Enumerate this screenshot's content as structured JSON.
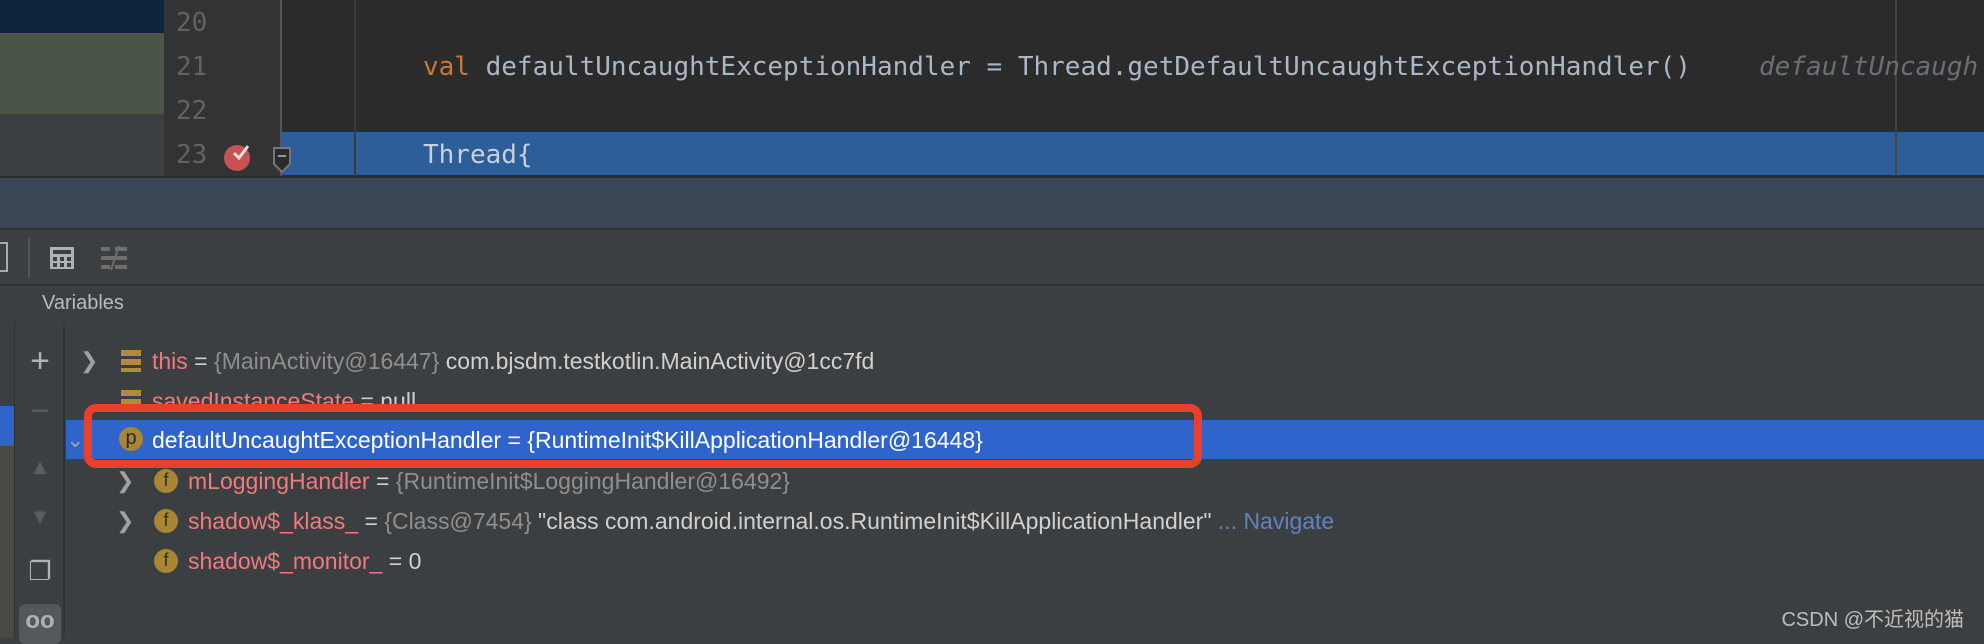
{
  "editor": {
    "lines": [
      {
        "number": "20",
        "code": ""
      },
      {
        "number": "21",
        "keyword": "val",
        "code": " defaultUncaughtExceptionHandler = Thread.getDefaultUncaughtExceptionHandler()",
        "hint": "defaultUncaugh"
      },
      {
        "number": "22",
        "code": ""
      },
      {
        "number": "23",
        "code": "Thread{"
      }
    ],
    "current_line": "23",
    "breakpoint_line": "23"
  },
  "toolbar": {
    "icons": [
      "calculator-icon",
      "trace-icon"
    ]
  },
  "variables": {
    "title": "Variables",
    "tools": [
      "add-icon",
      "remove-icon",
      "up-icon",
      "down-icon",
      "copy-icon",
      "watch-icon"
    ],
    "rows": [
      {
        "name": "this",
        "eq": " = ",
        "type": "{MainActivity@16447}",
        "value": " com.bjsdm.testkotlin.MainActivity@1cc7fd",
        "icon": "bars",
        "expandable": true
      },
      {
        "name": "savedInstanceState",
        "eq": " = ",
        "type": "",
        "value": "null",
        "icon": "bars",
        "expandable": false
      },
      {
        "name": "defaultUncaughtExceptionHandler",
        "eq": " = ",
        "type": "",
        "value": "{RuntimeInit$KillApplicationHandler@16448}",
        "icon": "p",
        "expandable": true,
        "selected": true
      },
      {
        "name": "mLoggingHandler",
        "eq": " = ",
        "type": "{RuntimeInit$LoggingHandler@16492}",
        "value": "",
        "icon": "f",
        "expandable": true
      },
      {
        "name": "shadow$_klass_",
        "eq": " = ",
        "type": "{Class@7454}",
        "value": " \"class com.android.internal.os.RuntimeInit$KillApplicationHandler\"",
        "link": " ... Navigate",
        "icon": "f",
        "expandable": true
      },
      {
        "name": "shadow$_monitor_",
        "eq": " = ",
        "type": "",
        "value": "0",
        "icon": "f",
        "expandable": false
      }
    ]
  },
  "watermark": "CSDN @不近视的猫",
  "colors": {
    "selection": "#2f65ca",
    "highlight_box": "#e8402a",
    "current_line": "#2d5e99"
  }
}
